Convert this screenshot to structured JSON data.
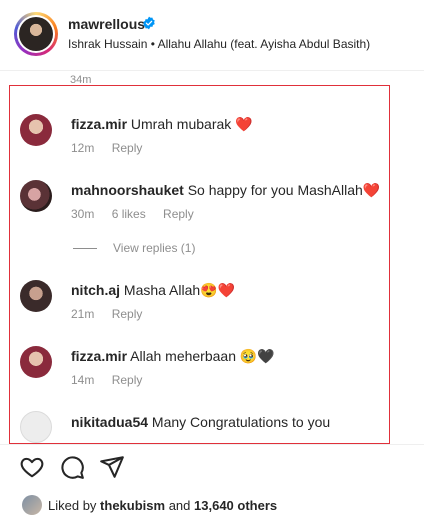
{
  "post": {
    "username": "mawrellous",
    "song": "Ishrak Hussain • Allahu Allahu (feat. Ayisha Abdul Basith)"
  },
  "time_stub": "34m",
  "comments": [
    {
      "user": "fizza.mir",
      "text": "Umrah mubarak",
      "emoji": "❤️",
      "time": "12m",
      "likes": "",
      "reply": "Reply"
    },
    {
      "user": "mahnoorshauket",
      "text": "So happy for you MashAllah",
      "emoji": "❤️",
      "time": "30m",
      "likes": "6 likes",
      "reply": "Reply"
    },
    {
      "user": "nitch.aj",
      "text": "Masha Allah",
      "emoji": "😍❤️",
      "time": "21m",
      "likes": "",
      "reply": "Reply"
    },
    {
      "user": "fizza.mir",
      "text": "Allah meherbaan",
      "emoji": "🥹🖤",
      "time": "14m",
      "likes": "",
      "reply": "Reply"
    },
    {
      "user": "nikitadua54",
      "text": "Many Congratulations to you",
      "emoji": "",
      "time": "",
      "likes": "",
      "reply": ""
    }
  ],
  "view_replies": "View replies (1)",
  "actions": {
    "like": "heart-icon",
    "comment": "comment-icon",
    "share": "share-icon"
  },
  "likes": {
    "prefix": "Liked by",
    "user": "thekubism",
    "middle": "and",
    "count": "13,640 others"
  },
  "colors": {
    "highlight_border": "#e0303a",
    "verified": "#0095f6",
    "muted": "#8e8e8e"
  }
}
